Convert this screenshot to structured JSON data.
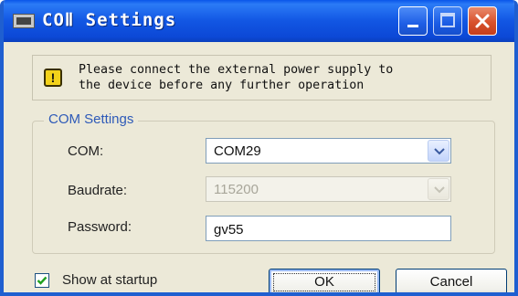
{
  "window": {
    "title": "COⅡ Settings"
  },
  "notice": {
    "text": "Please connect the external power supply to\nthe device before any further operation"
  },
  "group": {
    "legend": "COM Settings"
  },
  "fields": {
    "com_label": "COM:",
    "com_value": "COM29",
    "baudrate_label": "Baudrate:",
    "baudrate_value": "115200",
    "password_label": "Password:",
    "password_value": "gv55"
  },
  "footer": {
    "show_at_startup_label": "Show at startup",
    "show_at_startup_checked": true,
    "ok_label": "OK",
    "cancel_label": "Cancel"
  },
  "icons": {
    "title_icon": "window-app-icon",
    "notice_icon": "warning-icon",
    "dropdown_icon": "chevron-down-icon"
  },
  "colors": {
    "titlebar": "#1256e3",
    "close_button": "#d8512c",
    "legend_text": "#2e5ab8",
    "window_bg": "#ece9d8"
  }
}
